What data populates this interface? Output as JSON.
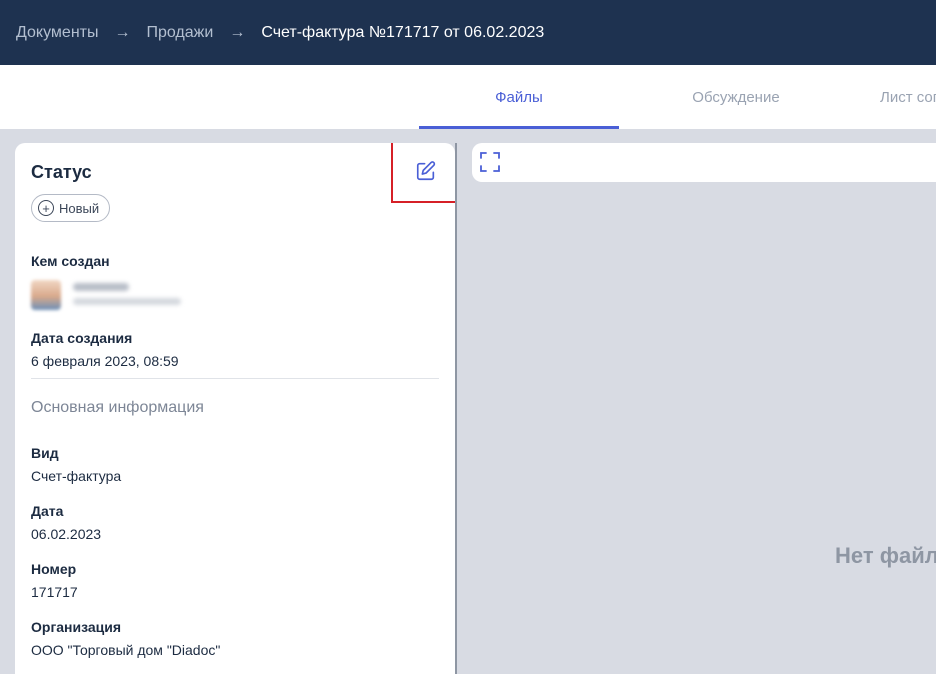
{
  "breadcrumb": {
    "items": [
      "Документы",
      "Продажи"
    ],
    "current": "Счет-фактура №171717 от 06.02.2023",
    "separator": "→"
  },
  "tabs": [
    {
      "label": "Файлы",
      "active": true
    },
    {
      "label": "Обсуждение",
      "active": false
    },
    {
      "label": "Лист согласования",
      "active": false
    }
  ],
  "status": {
    "title": "Статус",
    "badge": "Новый",
    "badge_icon": "plus-circle-icon",
    "edit_icon": "edit-icon"
  },
  "created_by": {
    "label": "Кем создан"
  },
  "created_at": {
    "label": "Дата создания",
    "value": "6 февраля 2023, 08:59"
  },
  "main_info": {
    "title": "Основная информация",
    "fields": [
      {
        "label": "Вид",
        "value": "Счет-фактура"
      },
      {
        "label": "Дата",
        "value": "06.02.2023"
      },
      {
        "label": "Номер",
        "value": "171717"
      },
      {
        "label": "Организация",
        "value": "ООО \"Торговый дом \"Diadoc\""
      }
    ]
  },
  "viewer": {
    "empty_text": "Нет файлов",
    "fullscreen_icon": "fullscreen-icon"
  },
  "colors": {
    "topbar": "#1e3250",
    "accent": "#4a5fd6",
    "highlight": "#d62027"
  }
}
